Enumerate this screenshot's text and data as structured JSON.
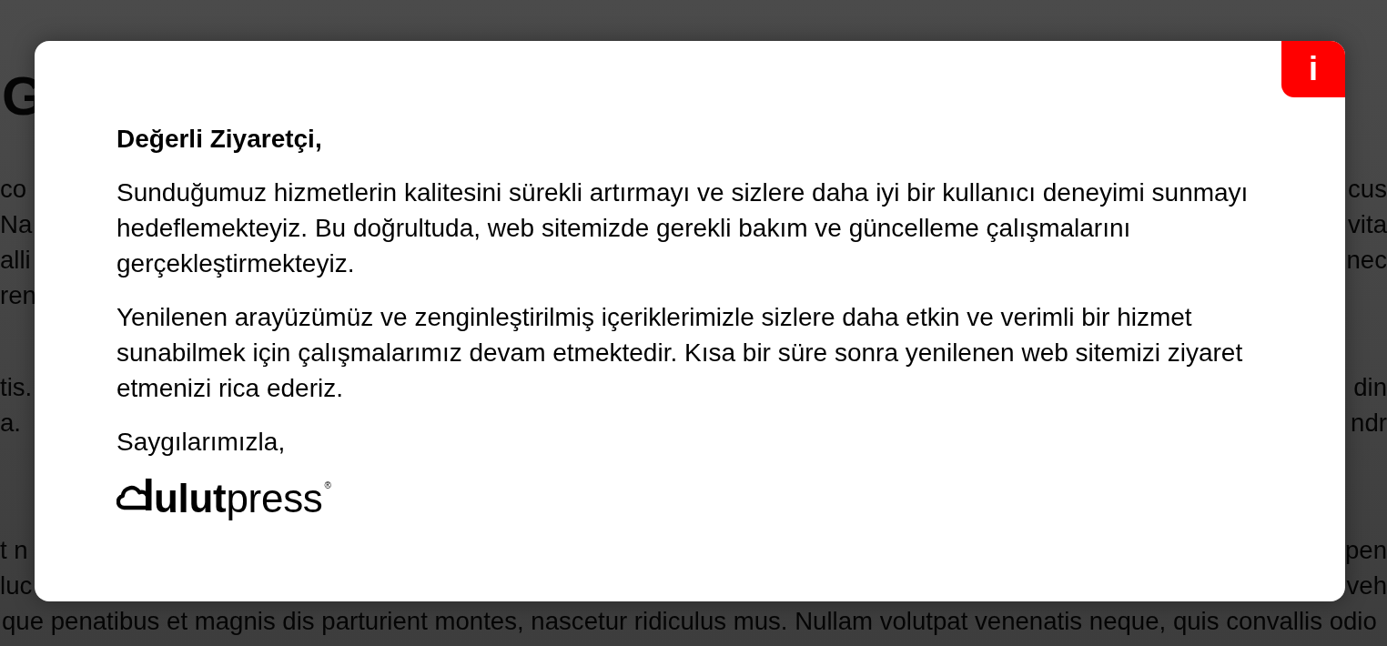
{
  "background_page": {
    "heading": "G",
    "paragraphs": [
      {
        "lines": [
          {
            "kind": "edges",
            "left": "co",
            "right": "cus"
          },
          {
            "kind": "edges",
            "left": "Na",
            "right": "vita"
          },
          {
            "kind": "edges",
            "left": "alli",
            "right": "nec"
          },
          {
            "kind": "edges",
            "left": "ren"
          }
        ]
      },
      {
        "lines": [
          {
            "kind": "edges",
            "left": "tis.",
            "right": "din"
          },
          {
            "kind": "edges",
            "left": "a.",
            "right": "ndr"
          }
        ]
      },
      {
        "lines": [
          {
            "kind": "edges",
            "left": "t n",
            "right": "pen"
          },
          {
            "kind": "edges",
            "left": "luc",
            "right": "veh"
          },
          {
            "kind": "full",
            "text": "que penatibus et magnis dis parturient montes, nascetur ridiculus mus. Nullam volutpat venenatis neque, quis convallis odio"
          }
        ]
      }
    ]
  },
  "modal": {
    "badge": "i",
    "greeting": "Değerli Ziyaretçi,",
    "paragraphs": [
      "Sunduğumuz hizmetlerin kalitesini sürekli artırmayı ve sizlere daha iyi bir kullanıcı deneyimi sunmayı hedeflemekteyiz. Bu doğrultuda, web sitemizde gerekli bakım ve güncelleme çalışmalarını gerçekleştirmekteyiz.",
      "Yenilenen arayüzümüz ve zenginleştirilmiş içeriklerimizle sizlere daha etkin ve verimli bir hizmet sunabilmek için çalışmalarımız devam etmektedir. Kısa bir süre sonra yenilenen web sitemizi ziyaret etmenizi rica ederiz."
    ],
    "closing": "Saygılarımızla,",
    "logo": {
      "text": "**ulut**press$^{®}$"
    }
  }
}
